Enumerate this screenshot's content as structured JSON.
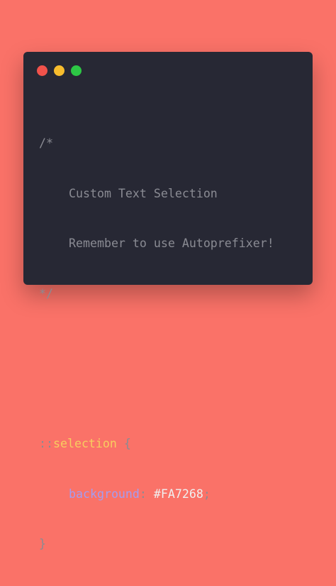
{
  "theme": {
    "page_background": "#FA7268",
    "editor_background": "#272834",
    "comment_color": "#8a8b93",
    "punctuation_color": "#8a8b93",
    "selector_color": "#f8cd5f",
    "property_color": "#a49cf0",
    "value_color": "#f0f0f0"
  },
  "window_controls": [
    {
      "name": "close",
      "color": "#F1524B"
    },
    {
      "name": "minimize",
      "color": "#F7BC2D"
    },
    {
      "name": "maximize",
      "color": "#2DC745"
    }
  ],
  "code": {
    "comment_open": "/*",
    "comment_line1": "Custom Text Selection",
    "comment_line2": "Remember to use Autoprefixer!",
    "comment_close": "*/",
    "selector_colons": "::",
    "selector_name": "selection",
    "open_brace": "{",
    "property": "background",
    "colon": ":",
    "value": "#FA7268",
    "semicolon": ";",
    "close_brace": "}"
  }
}
